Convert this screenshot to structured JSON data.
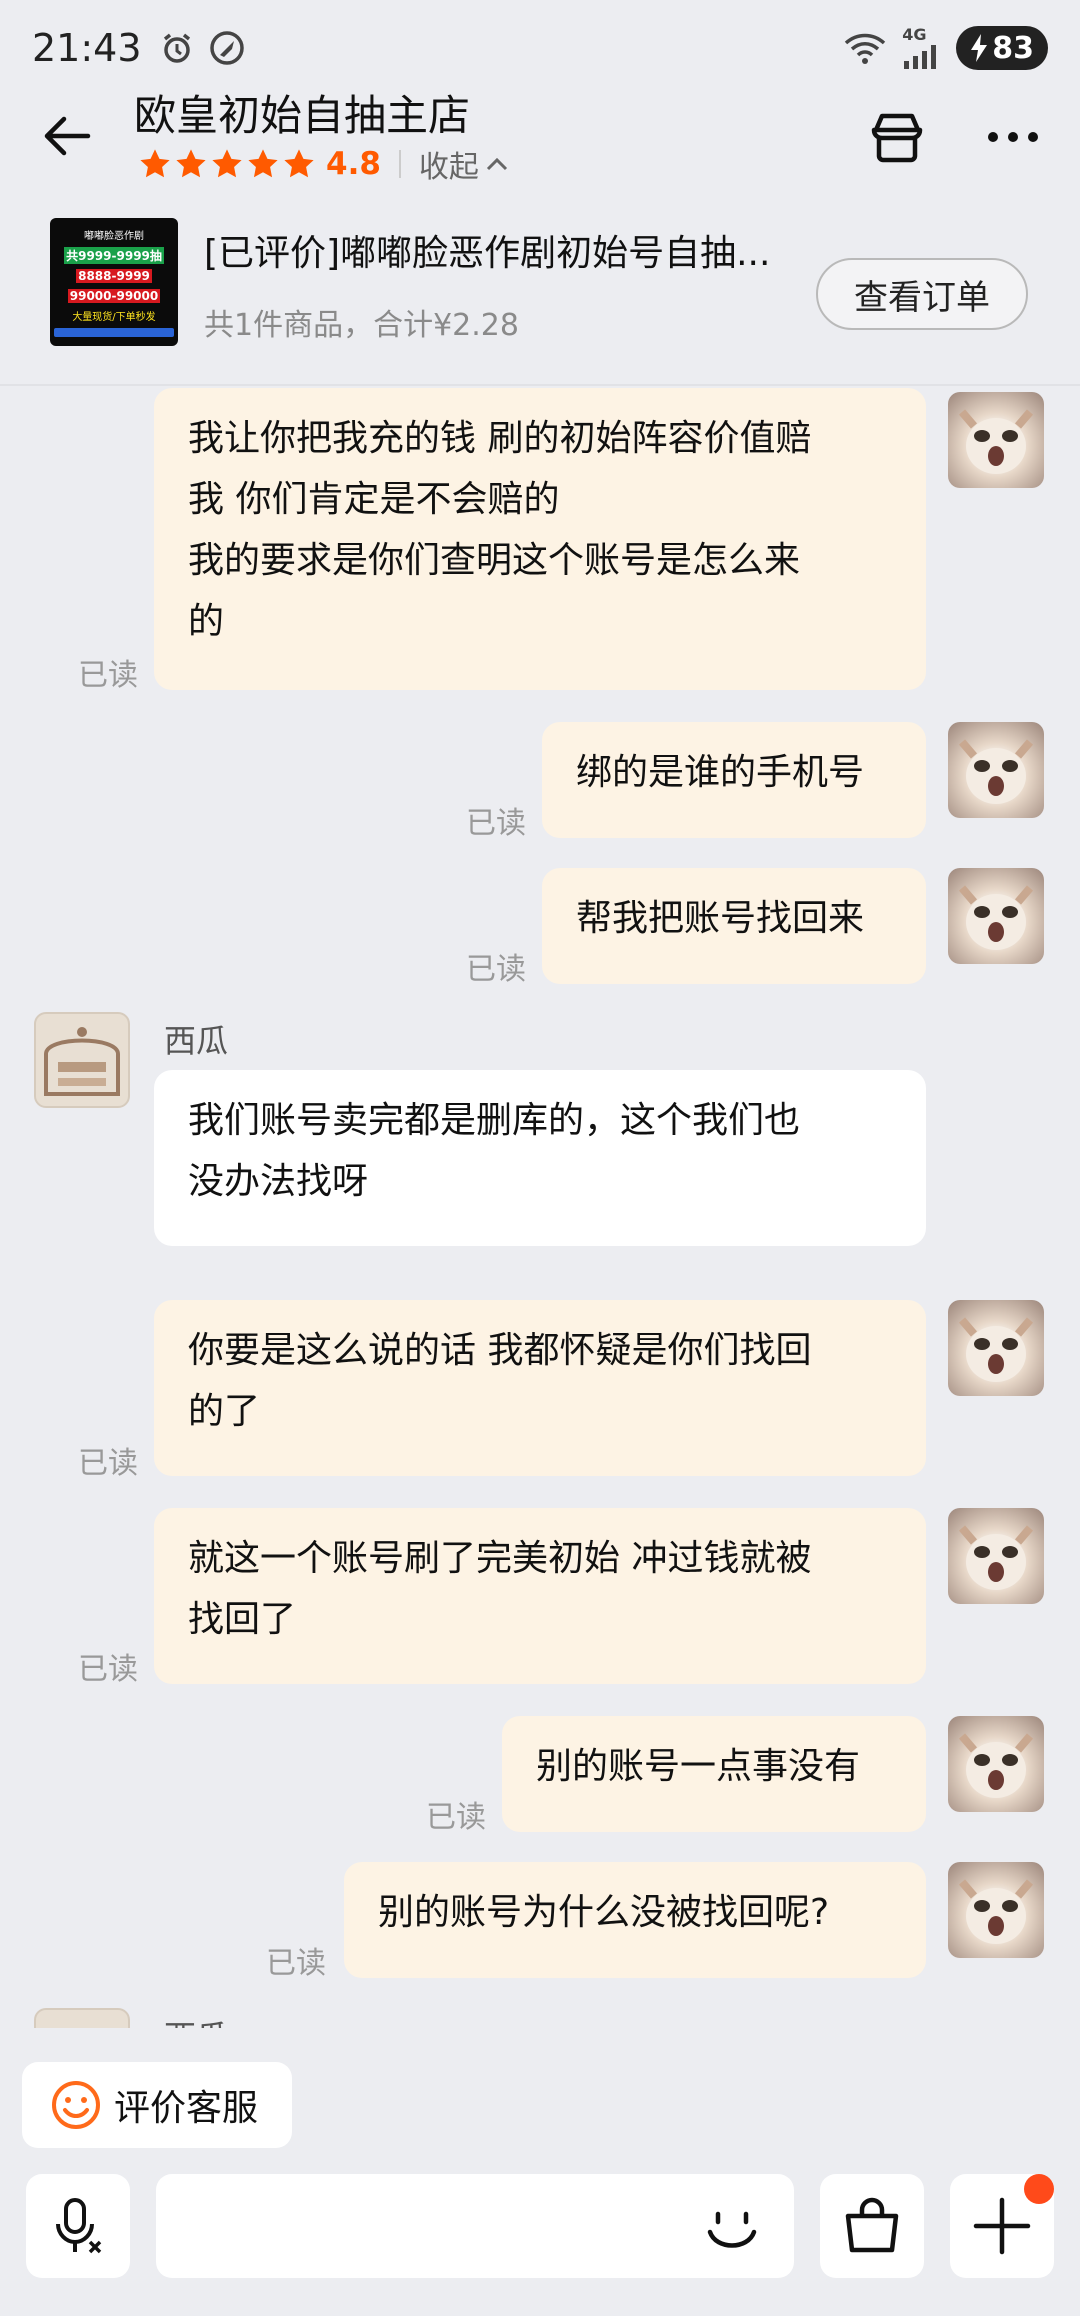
{
  "status_bar": {
    "time": "21:43",
    "network": "4G",
    "battery": "83"
  },
  "header": {
    "shop_name": "欧皇初始自抽主店",
    "rating": "4.8",
    "collapse_label": "收起",
    "star_color": "#ff5a00"
  },
  "order": {
    "title": "[已评价]嘟嘟脸恶作剧初始号自抽...",
    "summary": "共1件商品，合计¥2.28",
    "view_order_label": "查看订单",
    "thumbnail_text": {
      "line1": "嘟嘟脸恶作剧",
      "line2": "共9999-9999抽",
      "line3": "8888-9999",
      "line4": "99000-99000",
      "line5": "大量现货/下单秒发"
    }
  },
  "chat": {
    "read_label": "已读",
    "messages": [
      {
        "from": "me",
        "text_lines": [
          "我让你把我充的钱 刷的初始阵容价值赔",
          "我 你们肯定是不会赔的",
          "我的要求是你们查明这个账号是怎么来",
          "的"
        ]
      },
      {
        "from": "me",
        "text_lines": [
          "绑的是谁的手机号"
        ]
      },
      {
        "from": "me",
        "text_lines": [
          "帮我把账号找回来"
        ]
      },
      {
        "from": "them",
        "sender": "西瓜",
        "text_lines": [
          "我们账号卖完都是删库的，这个我们也",
          "没办法找呀"
        ]
      },
      {
        "from": "me",
        "text_lines": [
          "你要是这么说的话 我都怀疑是你们找回",
          "的了"
        ]
      },
      {
        "from": "me",
        "text_lines": [
          "就这一个账号刷了完美初始 冲过钱就被",
          "找回了"
        ]
      },
      {
        "from": "me",
        "text_lines": [
          "别的账号一点事没有"
        ]
      },
      {
        "from": "me",
        "text_lines": [
          "别的账号为什么没被找回呢?"
        ]
      }
    ],
    "next_sender_partial": "西瓜"
  },
  "bottom": {
    "rate_service_label": "评价客服",
    "input_placeholder": "",
    "accent_color": "#ff4a1a"
  }
}
